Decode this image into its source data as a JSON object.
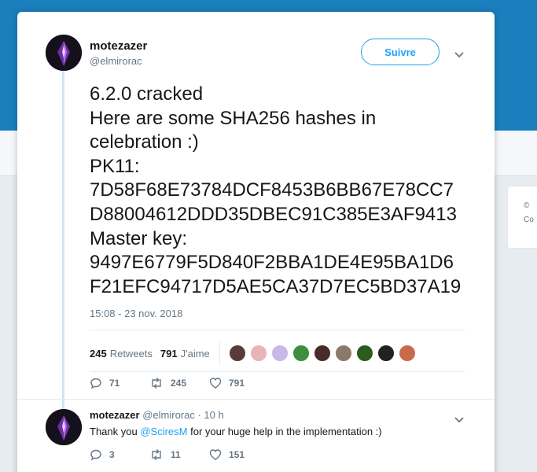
{
  "background": {
    "right_card_lines": [
      "©",
      "Co"
    ]
  },
  "tweet": {
    "display_name": "motezazer",
    "handle": "@elmirorac",
    "follow_label": "Suivre",
    "text_lines": [
      "6.2.0 cracked",
      "Here are some SHA256 hashes in",
      "celebration :)",
      "PK11:",
      "7D58F68E73784DCF8453B6BB67E78CC7",
      "D88004612DDD35DBEC91C385E3AF9413",
      "Master key:",
      "9497E6779F5D840F2BBA1DE4E95BA1D6",
      "F21EFC94717D5AE5CA37D7EC5BD37A19"
    ],
    "timestamp": "15:08 - 23 nov. 2018",
    "retweets_count": "245",
    "retweets_label": "Retweets",
    "likes_count": "791",
    "likes_label": "J'aime",
    "liker_colors": [
      "#5a3a3a",
      "#e8b4b8",
      "#c9b8e8",
      "#3e8e3e",
      "#4a2a2a",
      "#8a7a6a",
      "#2d5a1d",
      "#222222",
      "#c86a4a"
    ],
    "actions": {
      "replies": "71",
      "retweets": "245",
      "likes": "791"
    }
  },
  "reply": {
    "display_name": "motezazer",
    "handle_time": "@elmirorac · 10 h",
    "text_before": "Thank you ",
    "mention": "@SciresM",
    "text_after": " for your huge help in the implementation :)",
    "actions": {
      "replies": "3",
      "retweets": "11",
      "likes": "151"
    }
  },
  "colors": {
    "accent": "#1da1f2",
    "header": "#1b7fbd",
    "avatar_crystal": "#9b4fd1"
  }
}
